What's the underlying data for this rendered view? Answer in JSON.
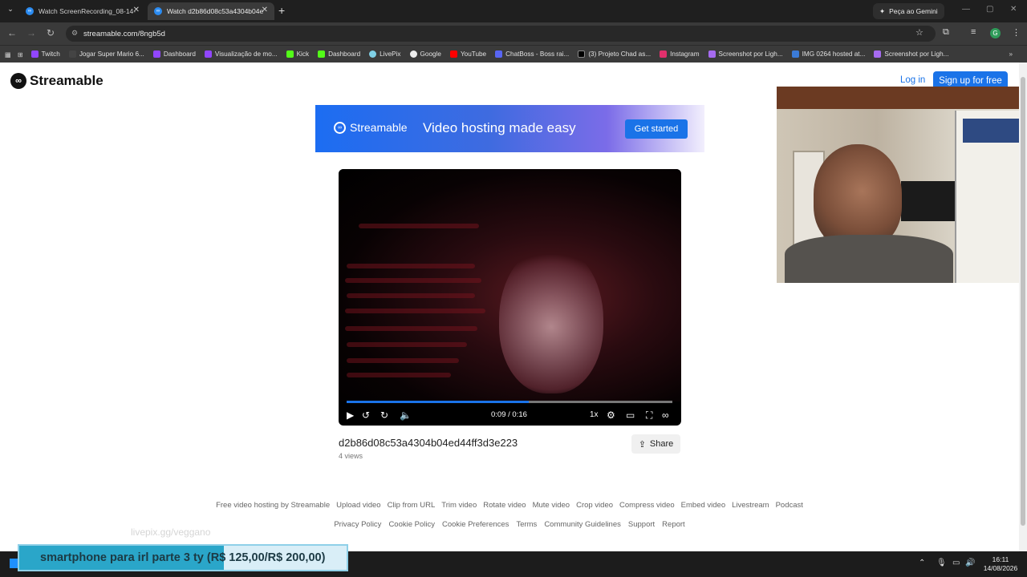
{
  "browser": {
    "tabs": [
      {
        "title": "Watch ScreenRecording_08-14-",
        "active": false
      },
      {
        "title": "Watch d2b86d08c53a4304b04e",
        "active": true
      }
    ],
    "gemini_label": "Peça ao Gemini",
    "url": "streamable.com/8ngb5d",
    "profile_initial": "G",
    "bookmarks": [
      "Twitch",
      "Jogar Super Mario 6...",
      "Dashboard",
      "Visualização de mo...",
      "Kick",
      "Dashboard",
      "LivePix",
      "Google",
      "YouTube",
      "ChatBoss - Boss rai...",
      "(3) Projeto Chad as...",
      "Instagram",
      "Screenshot por Ligh...",
      "IMG 0264 hosted at...",
      "Screenshot por Ligh..."
    ]
  },
  "site": {
    "logo": "Streamable",
    "login": "Log in",
    "signup": "Sign up for free"
  },
  "banner": {
    "brand": "Streamable",
    "headline": "Video hosting made easy",
    "cta": "Get started"
  },
  "player": {
    "timecode": "0:09 / 0:16",
    "progress": 0.56,
    "speed": "1x"
  },
  "video": {
    "title": "d2b86d08c53a4304b04ed44ff3d3e223",
    "views": "4 views",
    "share": "Share"
  },
  "footer": {
    "row1": [
      "Free video hosting by Streamable",
      "Upload video",
      "Clip from URL",
      "Trim video",
      "Rotate video",
      "Mute video",
      "Crop video",
      "Compress video",
      "Embed video",
      "Livestream",
      "Podcast"
    ],
    "row2": [
      "Privacy Policy",
      "Cookie Policy",
      "Cookie Preferences",
      "Terms",
      "Community Guidelines",
      "Support",
      "Report"
    ]
  },
  "overlay": {
    "livepix": "livepix.gg/veggano",
    "goal_text": "smartphone para irl parte 3 ty (R$ 125,00/R$ 200,00)",
    "goal_progress": 0.625
  },
  "taskbar": {
    "time": "16:11",
    "date": "14/08/2026"
  }
}
